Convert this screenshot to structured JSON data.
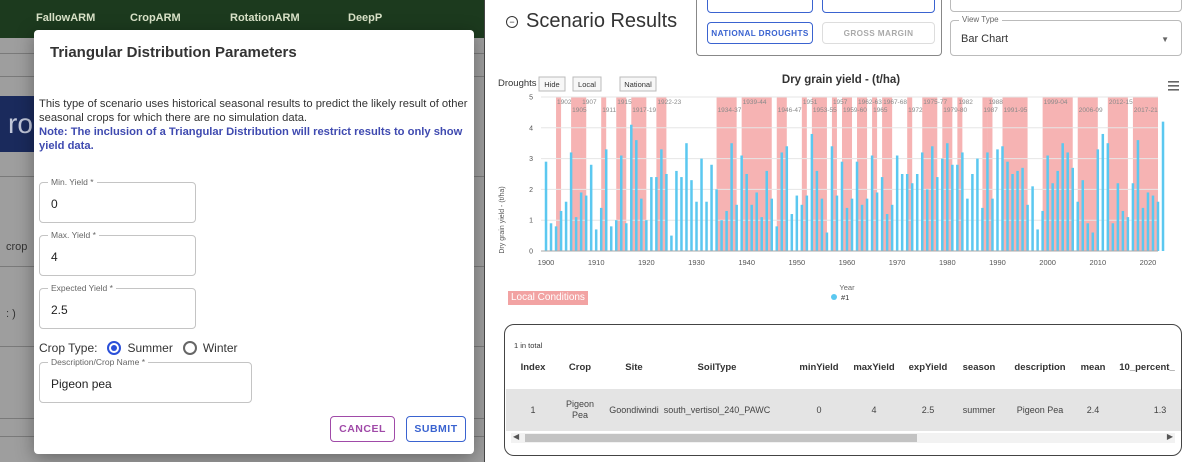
{
  "nav": {
    "items": [
      "FallowARM",
      "CropARM",
      "RotationARM",
      "DeepP"
    ]
  },
  "background": {
    "banner_text": "ro",
    "crop_label": "crop",
    "paren_label": ": )"
  },
  "modal": {
    "title": "Triangular Distribution Parameters",
    "description": "This type of scenario uses historical seasonal results to predict the likely result of other seasonal crops for which there are no simulation data.",
    "note": "Note: The inclusion of a Triangular Distribution will restrict results to only show yield data.",
    "min_yield": {
      "label": "Min. Yield *",
      "value": "0"
    },
    "max_yield": {
      "label": "Max. Yield *",
      "value": "4"
    },
    "expected_yield": {
      "label": "Expected Yield *",
      "value": "2.5"
    },
    "crop_type": {
      "label": "Crop Type:",
      "options": [
        "Summer",
        "Winter"
      ],
      "selected": "Summer"
    },
    "description_field": {
      "label": "Description/Crop Name *",
      "value": "Pigeon pea"
    },
    "cancel_label": "CANCEL",
    "submit_label": "SUBMIT"
  },
  "results": {
    "title": "Scenario Results",
    "national_droughts_label": "NATIONAL DROUGHTS",
    "gross_margin_label": "GROSS MARGIN",
    "view_type": {
      "label": "View Type",
      "value": "Bar Chart"
    }
  },
  "chart_controls": {
    "droughts_label": "Droughts",
    "hide_label": "Hide",
    "local_label": "Local",
    "national_label": "National",
    "menu_icon": "hamburger-menu-icon"
  },
  "chart_data": {
    "type": "bar",
    "title": "Dry grain yield - (t/ha)",
    "xlabel": "Year",
    "ylabel": "Dry grain yield - (t/ha)",
    "xlim": [
      1899,
      2022
    ],
    "ylim": [
      0,
      5
    ],
    "xticks": [
      1900,
      1910,
      1920,
      1930,
      1940,
      1950,
      1960,
      1970,
      1980,
      1990,
      2000,
      2010,
      2020
    ],
    "yticks": [
      0,
      1,
      2,
      3,
      4,
      5
    ],
    "bar_color": "#5bc8f0",
    "drought_color": "#f6b3b3",
    "series": [
      {
        "name": "#1",
        "start_year": 1900,
        "values": [
          2.9,
          0.9,
          0.8,
          1.3,
          1.6,
          3.2,
          1.1,
          1.9,
          1.8,
          2.8,
          0.7,
          1.4,
          3.3,
          0.8,
          1.0,
          3.1,
          0.9,
          4.1,
          3.6,
          1.7,
          1.0,
          2.4,
          2.4,
          3.3,
          2.5,
          0.5,
          2.6,
          2.4,
          3.5,
          2.3,
          1.6,
          3.0,
          1.6,
          2.8,
          2.0,
          1.0,
          1.3,
          3.5,
          1.5,
          3.1,
          2.5,
          1.5,
          1.9,
          1.1,
          2.6,
          1.7,
          0.8,
          3.2,
          3.4,
          1.2,
          1.8,
          1.5,
          1.8,
          3.8,
          2.6,
          1.7,
          0.6,
          3.4,
          1.8,
          2.9,
          1.4,
          1.7,
          2.9,
          1.5,
          1.7,
          3.1,
          1.9,
          2.4,
          1.2,
          1.5,
          3.1,
          2.5,
          2.5,
          2.2,
          2.5,
          3.2,
          2.0,
          3.4,
          2.4,
          3.0,
          3.5,
          2.8,
          2.8,
          3.2,
          1.7,
          2.5,
          3.0,
          1.4,
          3.2,
          1.7,
          3.3,
          3.4,
          2.9,
          2.5,
          2.6,
          2.7,
          1.5,
          2.1,
          0.7,
          1.3,
          3.1,
          2.2,
          2.6,
          3.5,
          3.2,
          2.7,
          1.6,
          2.3,
          0.9,
          0.6,
          3.3,
          3.8,
          3.5,
          0.9,
          2.2,
          1.3,
          1.1,
          2.2,
          3.6,
          1.4,
          1.9,
          1.8,
          1.6,
          4.2
        ],
        "marker_color": "#5bc8f0"
      }
    ],
    "drought_bands": [
      {
        "start": 1902,
        "end": 1903,
        "label": "1902"
      },
      {
        "start": 1905,
        "end": 1908,
        "label": "1905"
      },
      {
        "start": 1907,
        "end": 1908,
        "label": "1907"
      },
      {
        "start": 1911,
        "end": 1912,
        "label": "1911"
      },
      {
        "start": 1914,
        "end": 1916,
        "label": "1915"
      },
      {
        "start": 1917,
        "end": 1920,
        "label": "1917-19"
      },
      {
        "start": 1922,
        "end": 1924,
        "label": "1922-23"
      },
      {
        "start": 1934,
        "end": 1938,
        "label": "1934-37"
      },
      {
        "start": 1939,
        "end": 1945,
        "label": "1939-44"
      },
      {
        "start": 1946,
        "end": 1948,
        "label": "1946-47"
      },
      {
        "start": 1951,
        "end": 1952,
        "label": "1951"
      },
      {
        "start": 1953,
        "end": 1956,
        "label": "1953-55"
      },
      {
        "start": 1957,
        "end": 1958,
        "label": "1957"
      },
      {
        "start": 1959,
        "end": 1961,
        "label": "1959-60"
      },
      {
        "start": 1962,
        "end": 1964,
        "label": "1962-63"
      },
      {
        "start": 1965,
        "end": 1966,
        "label": "1965"
      },
      {
        "start": 1967,
        "end": 1969,
        "label": "1967-68"
      },
      {
        "start": 1972,
        "end": 1973,
        "label": "1972"
      },
      {
        "start": 1975,
        "end": 1978,
        "label": "1975-77"
      },
      {
        "start": 1979,
        "end": 1981,
        "label": "1979-80"
      },
      {
        "start": 1982,
        "end": 1983,
        "label": "1982"
      },
      {
        "start": 1987,
        "end": 1988,
        "label": "1987"
      },
      {
        "start": 1988,
        "end": 1989,
        "label": "1988"
      },
      {
        "start": 1991,
        "end": 1996,
        "label": "1991-95"
      },
      {
        "start": 1999,
        "end": 2005,
        "label": "1999-04"
      },
      {
        "start": 2006,
        "end": 2010,
        "label": "2006-09"
      },
      {
        "start": 2012,
        "end": 2016,
        "label": "2012-15"
      },
      {
        "start": 2017,
        "end": 2022,
        "label": "2017-21"
      }
    ],
    "legend": [
      {
        "label": "Local Conditions",
        "color": "#f6b3b3"
      },
      {
        "label": "#1",
        "color": "#5bc8f0"
      }
    ],
    "grid": true
  },
  "table": {
    "count_text": "1 in total",
    "headers": [
      "Index",
      "Crop",
      "Site",
      "SoilType",
      "minYield",
      "maxYield",
      "expYield",
      "season",
      "description",
      "mean",
      "10_percent_"
    ],
    "rows": [
      [
        "1",
        "Pigeon Pea",
        "Goondiwindi",
        "south_vertisol_240_PAWC",
        "0",
        "4",
        "2.5",
        "summer",
        "Pigeon Pea",
        "2.4",
        "1.3"
      ]
    ]
  }
}
